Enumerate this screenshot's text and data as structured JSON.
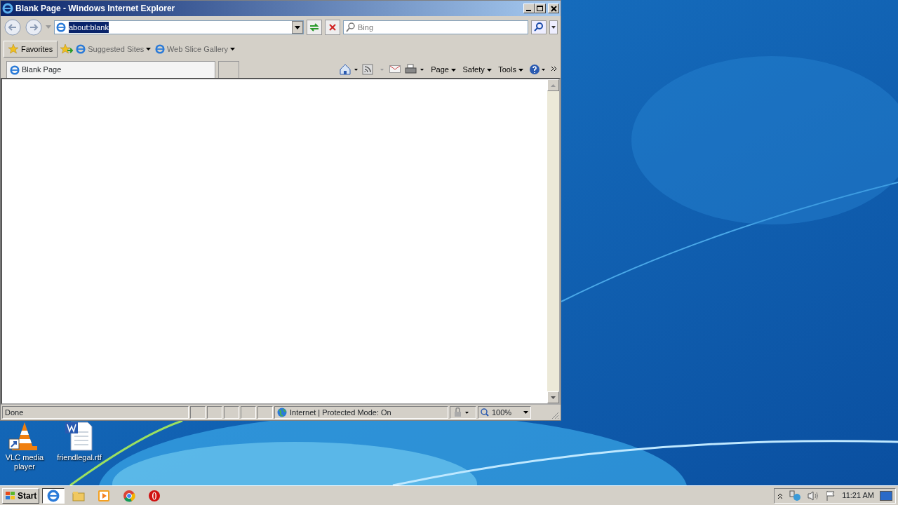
{
  "window": {
    "title": "Blank Page - Windows Internet Explorer"
  },
  "address_bar": {
    "value": "about:blank",
    "text_selected": true
  },
  "search": {
    "placeholder": "Bing"
  },
  "favorites_bar": {
    "button": "Favorites",
    "links": [
      {
        "label": "Suggested Sites"
      },
      {
        "label": "Web Slice Gallery"
      }
    ]
  },
  "tabs": [
    {
      "label": "Blank Page",
      "selected": true
    }
  ],
  "command_bar": {
    "menus": [
      "Page",
      "Safety",
      "Tools"
    ]
  },
  "status_bar": {
    "text": "Done",
    "zone": "Internet | Protected Mode: On",
    "zoom": "100%"
  },
  "desktop_icons": [
    {
      "label": "VLC media player",
      "kind": "vlc"
    },
    {
      "label": "friendlegal.rtf",
      "kind": "document"
    }
  ],
  "taskbar": {
    "start": "Start",
    "clock": "11:21 AM"
  }
}
